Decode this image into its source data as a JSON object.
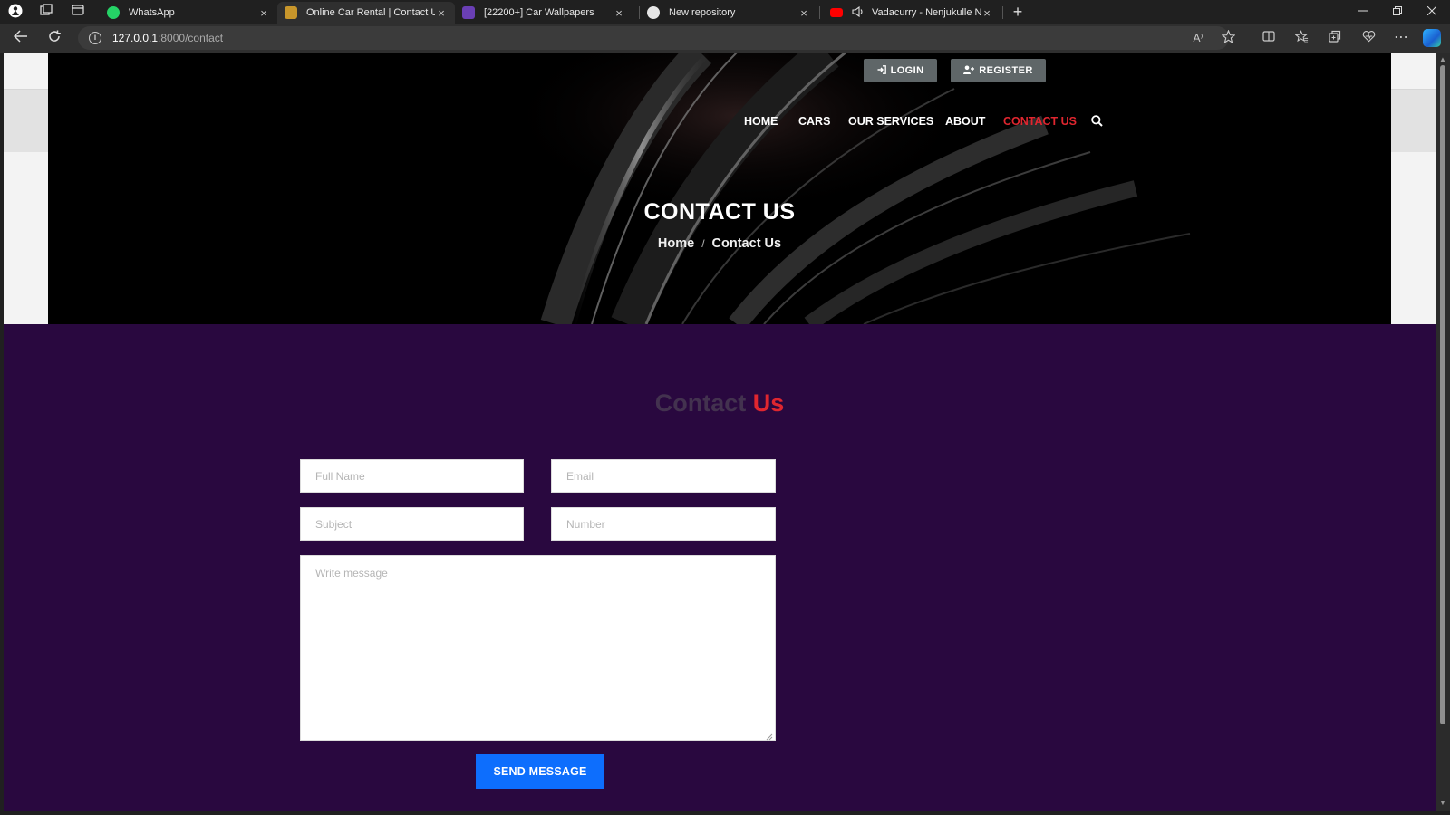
{
  "browser": {
    "tabs": [
      {
        "label": "WhatsApp",
        "active": false,
        "favicon_color": "#25d366"
      },
      {
        "label": "Online Car Rental | Contact Us",
        "active": true,
        "favicon_color": "#c8962b"
      },
      {
        "label": "[22200+] Car Wallpapers",
        "active": false,
        "favicon_color": "#6a3fb5"
      },
      {
        "label": "New repository",
        "active": false,
        "favicon_color": "#e6e6e6"
      },
      {
        "label": "Vadacurry - Nenjukulle Nee",
        "active": false,
        "favicon_color": "#ff0000"
      }
    ],
    "new_tab_symbol": "+",
    "close_symbol": "×",
    "url_host": "127.0.0.1",
    "url_rest": ":8000/contact",
    "read_aloud_label": "A⁾"
  },
  "site": {
    "auth": {
      "login": "LOGIN",
      "register": "REGISTER"
    },
    "menu": [
      "HOME",
      "CARS",
      "OUR SERVICES",
      "ABOUT",
      "CONTACT US"
    ],
    "active_menu": "CONTACT US",
    "hero_title": "CONTACT US",
    "breadcrumb": {
      "home": "Home",
      "separator": "/",
      "current": "Contact Us"
    },
    "contact_heading": {
      "part1": "Contact",
      "part2": "Us"
    },
    "form": {
      "full_name_placeholder": "Full Name",
      "email_placeholder": "Email",
      "subject_placeholder": "Subject",
      "number_placeholder": "Number",
      "message_placeholder": "Write message",
      "submit_label": "SEND MESSAGE"
    }
  },
  "colors": {
    "accent_red": "#e0262f",
    "section_bg": "#29083f",
    "submit_blue": "#0d6efd",
    "auth_btn_bg": "#5f6668"
  }
}
